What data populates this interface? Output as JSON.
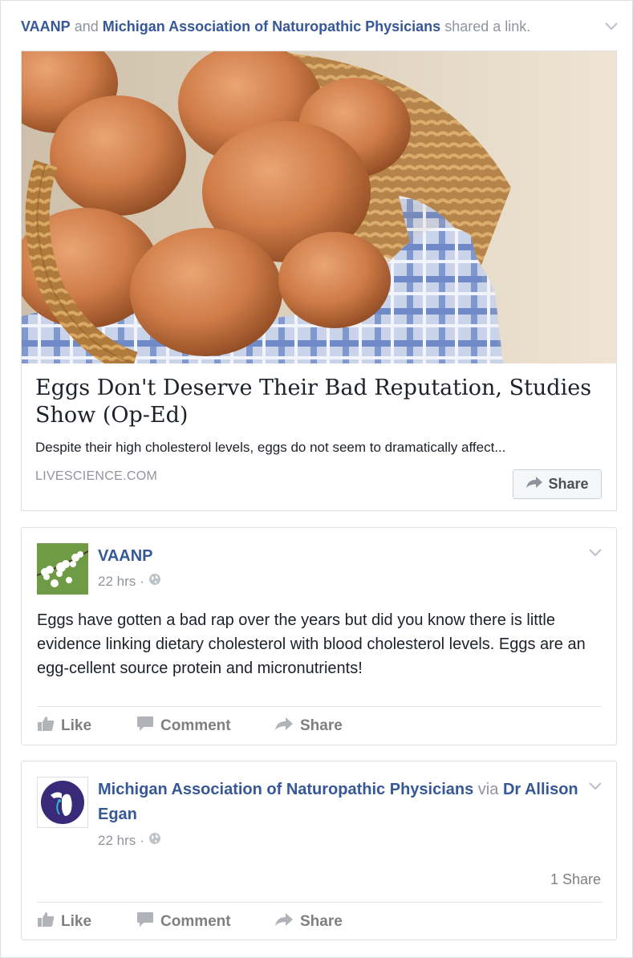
{
  "story": {
    "actor1": "VAANP",
    "and": "and",
    "actor2": "Michigan Association of Naturopathic Physicians",
    "action": "shared a link."
  },
  "link_card": {
    "title": "Eggs Don't Deserve Their Bad Reputation, Studies Show (Op-Ed)",
    "description": "Despite their high cholesterol levels, eggs do not seem to dramatically affect...",
    "domain": "LIVESCIENCE.COM",
    "share_label": "Share"
  },
  "post1": {
    "author": "VAANP",
    "time": "22 hrs",
    "separator": "·",
    "body": "Eggs have gotten a bad rap over the years but did you know there is little evidence linking dietary cholesterol with blood cholesterol levels. Eggs are an egg-cellent source protein and micronutrients!",
    "actions": {
      "like": "Like",
      "comment": "Comment",
      "share": "Share"
    }
  },
  "post2": {
    "author": "Michigan Association of Naturopathic Physicians",
    "via": "via",
    "via_author": "Dr Allison Egan",
    "time": "22 hrs",
    "separator": "·",
    "share_count": "1 Share",
    "actions": {
      "like": "Like",
      "comment": "Comment",
      "share": "Share"
    }
  },
  "icons": {
    "privacy": "globe-icon",
    "menu": "chevron-down-icon",
    "like": "thumbs-up-icon",
    "comment": "comment-icon",
    "share": "share-arrow-icon"
  },
  "colors": {
    "link": "#365899",
    "meta": "#90949c",
    "action": "#7f7f7f"
  }
}
